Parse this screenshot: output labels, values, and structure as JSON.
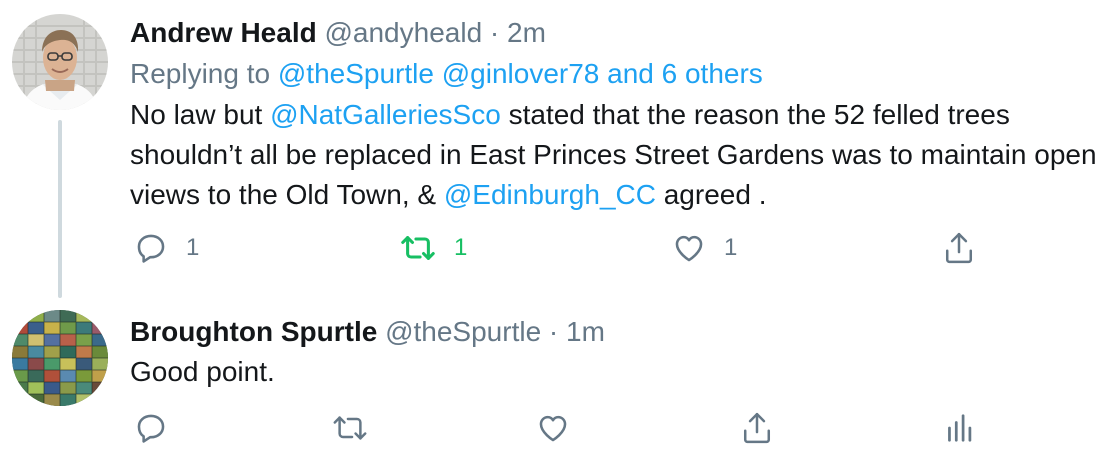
{
  "tweets": [
    {
      "display_name": "Andrew Heald",
      "handle": "@andyheald",
      "separator": " · ",
      "time": "2m",
      "replying_prefix": "Replying to ",
      "replying_user1": "@theSpurtle",
      "replying_user2": "@ginlover78",
      "replying_others": "and 6 others",
      "body_parts": {
        "t1": "No law but ",
        "m1": "@NatGalleriesSco",
        "t2": " stated that the reason the 52 felled trees shouldn’t all be replaced in East Princes Street Gardens was to maintain open views to the Old Town, & ",
        "m2": "@Edinburgh_CC",
        "t3": " agreed ."
      },
      "reply_count": "1",
      "retweet_count": "1",
      "like_count": "1",
      "retweeted": true
    },
    {
      "display_name": "Broughton Spurtle",
      "handle": "@theSpurtle",
      "separator": " · ",
      "time": "1m",
      "body": "Good point."
    }
  ],
  "icons": {
    "reply": "reply-icon",
    "retweet": "retweet-icon",
    "like": "heart-icon",
    "share": "share-icon",
    "analytics": "analytics-icon"
  },
  "colors": {
    "link": "#1da1f2",
    "muted": "#657786",
    "retweet_active": "#17bf63",
    "thread_line": "#cfd9de"
  }
}
